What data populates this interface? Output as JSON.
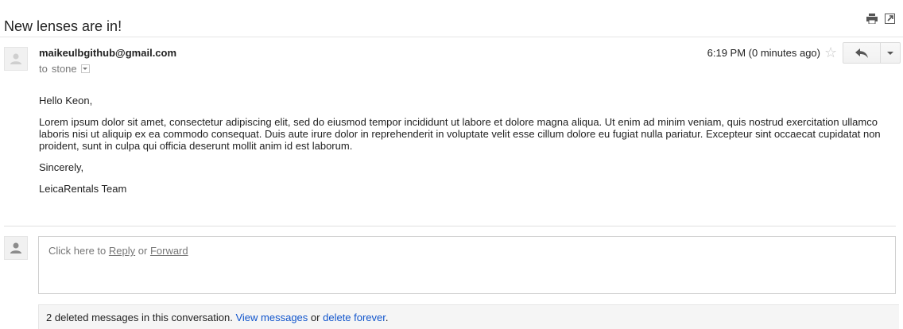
{
  "subject": "New lenses are in!",
  "toolbar": {
    "print_icon": "print-icon",
    "popout_icon": "open-in-new-window-icon"
  },
  "message": {
    "sender_email": "maikeulbgithub@gmail.com",
    "to_prefix": "to",
    "recipient": "stone",
    "timestamp": "6:19 PM (0 minutes ago)",
    "greeting": "Hello Keon,",
    "paragraph": "Lorem ipsum dolor sit amet, consectetur adipiscing elit, sed do eiusmod tempor incididunt ut labore et dolore magna aliqua. Ut enim ad minim veniam, quis nostrud exercitation ullamco laboris nisi ut aliquip ex ea commodo consequat. Duis aute irure dolor in reprehenderit in voluptate velit esse cillum dolore eu fugiat nulla pariatur. Excepteur sint occaecat cupidatat non proident, sunt in culpa qui officia deserunt mollit anim id est laborum.",
    "closing": "Sincerely,",
    "signature": "LeicaRentals Team"
  },
  "reply_box": {
    "prefix": "Click here to",
    "reply_link": "Reply",
    "or": "or",
    "forward_link": "Forward"
  },
  "deleted_notice": {
    "text": "2 deleted messages in this conversation.",
    "view_link": "View messages",
    "or": "or",
    "delete_link": "delete forever",
    "suffix": "."
  },
  "colors": {
    "link": "#1155cc",
    "star": "#c6c6c6"
  }
}
